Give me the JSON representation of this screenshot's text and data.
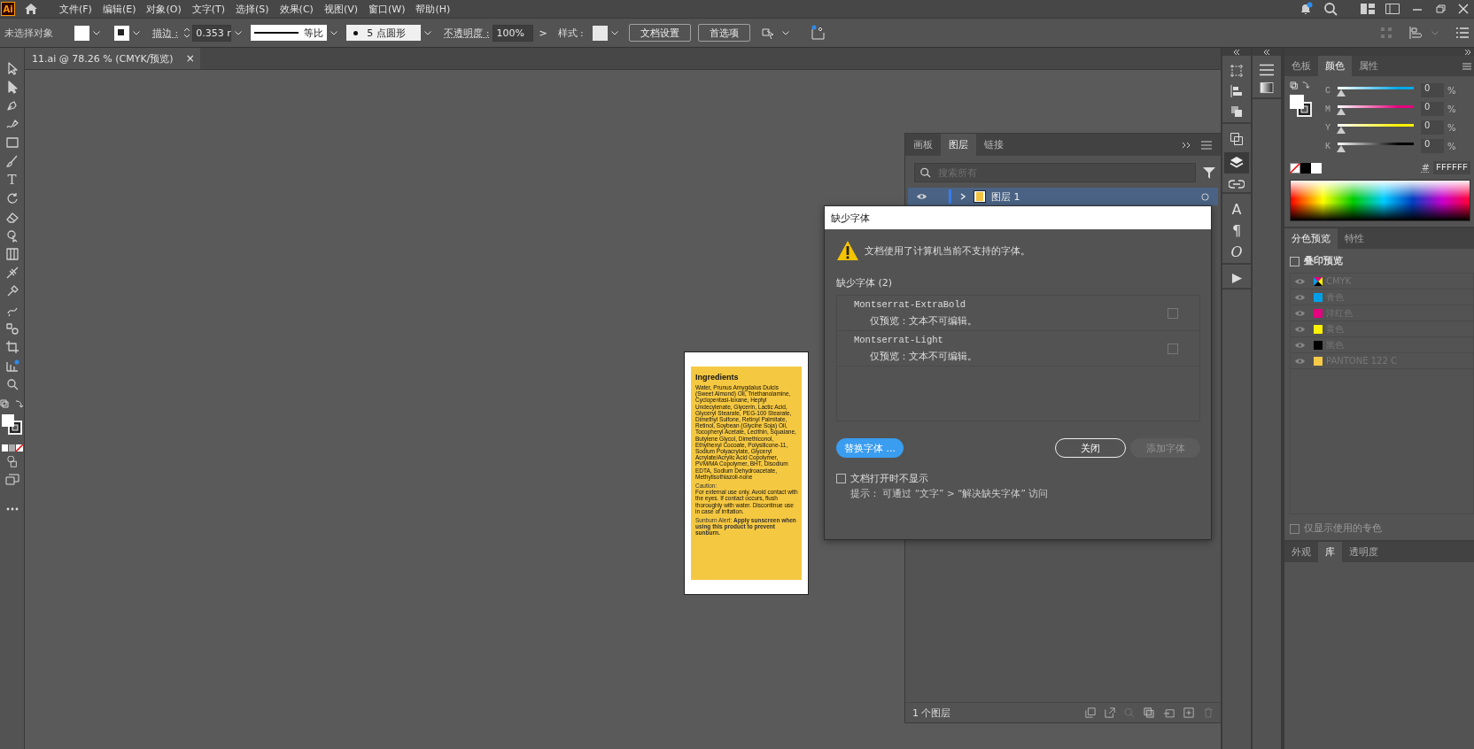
{
  "app": {
    "logo": "Ai"
  },
  "menu": [
    "文件(F)",
    "编辑(E)",
    "对象(O)",
    "文字(T)",
    "选择(S)",
    "效果(C)",
    "视图(V)",
    "窗口(W)",
    "帮助(H)"
  ],
  "control_bar": {
    "selection": "未选择对象",
    "stroke_label": "描边 :",
    "stroke_weight": "0.353 r",
    "stroke_profile": "等比",
    "brush": "5 点圆形",
    "opacity_label": "不透明度 :",
    "opacity": "100%",
    "opacity_arrow": ">",
    "style_label": "样式 :",
    "document_setup": "文档设置",
    "preferences": "首选项"
  },
  "document_tab": {
    "title": "11.ai @ 78.26 % (CMYK/预览)",
    "close": "×"
  },
  "toolbar": {
    "type_glyph": "T"
  },
  "artboard": {
    "heading": "Ingredients",
    "ingredients": "Water, Prunus Amygdalus Dulcis (Sweet Almond) Oil, Triethanolamine, Cyclopentasi-loxane, Heptyl Undecylenate, Glycerin, Lactic Acid, Glyceryl Stearate, PEG-100 Stearate, Dimethyl Sulfone, Retinyl Palmitate, Retinol, Soybean (Glycine Soja) Oil, Tocopheryl Acetate, Lecithin, Squalane, Butylene Glycol, Dimethiconol, Ethylhexyl Cocoate, Polysilicone-11, Sodium Polyacrylate, Glyceryl Acrylate/Acrylic Acid Copolymer, PVM/MA Copolymer, BHT, Disodium EDTA, Sodium Dehydroacetate, Methylisothiazoli-none",
    "caution_heading": "Caution:",
    "caution": "For external use only. Avoid contact with the eyes. If contact occurs, flush thoroughly with water. Discontinue use in case of irritation.",
    "sunburn": "Sunburn Alert: **Apply sunscreen when using this product to prevent sunburn.**"
  },
  "layers_panel": {
    "tabs": [
      {
        "label": "画板",
        "selected": false
      },
      {
        "label": "图层",
        "selected": true
      },
      {
        "label": "链接",
        "selected": false
      }
    ],
    "search": {
      "placeholder": "搜索所有"
    },
    "layers": [
      {
        "name": "图层 1",
        "visible": true,
        "expanded": false,
        "selected": true
      }
    ],
    "footer": "1 个图层"
  },
  "dialog": {
    "title": "缺少字体",
    "message": "文档使用了计算机当前不支持的字体。",
    "list_heading": "缺少字体 (2)",
    "fonts": [
      {
        "name": "Montserrat-ExtraBold",
        "note": "仅预览：文本不可编辑。",
        "checked": false
      },
      {
        "name": "Montserrat-Light",
        "note": "仅预览：文本不可编辑。",
        "checked": false
      }
    ],
    "replace_button": "替换字体 ...",
    "close_button": "关闭",
    "add_button": {
      "label": "添加字体",
      "disabled": true
    },
    "dont_show": {
      "label": "文档打开时不显示",
      "checked": false
    },
    "hint": "提示： 可通过 “文字” > “解决缺失字体” 访问"
  },
  "dock": {
    "character_glyph": "A",
    "paragraph_glyph": "¶",
    "opentype_glyph": "O"
  },
  "color_panel": {
    "tabs": [
      {
        "label": "色板",
        "selected": false
      },
      {
        "label": "颜色",
        "selected": true
      },
      {
        "label": "属性",
        "selected": false
      }
    ],
    "channels": [
      {
        "name": "C",
        "value": "0",
        "unit": "%",
        "level": 0,
        "color": "#00a8e8"
      },
      {
        "name": "M",
        "value": "0",
        "unit": "%",
        "level": 0,
        "color": "#e6007e"
      },
      {
        "name": "Y",
        "value": "0",
        "unit": "%",
        "level": 0,
        "color": "#fff000"
      },
      {
        "name": "K",
        "value": "0",
        "unit": "%",
        "level": 0,
        "color": "#000000"
      }
    ],
    "hash": "#",
    "hex": "FFFFFF"
  },
  "separations_panel": {
    "tabs": [
      {
        "label": "分色预览",
        "selected": true
      },
      {
        "label": "特性",
        "selected": false
      }
    ],
    "overprint": {
      "label": "叠印预览",
      "checked": false
    },
    "inks": [
      {
        "name": "CMYK",
        "kind": "composite"
      },
      {
        "name": "青色",
        "kind": "ink",
        "color": "#00a0e9"
      },
      {
        "name": "洋红色",
        "kind": "ink",
        "color": "#e4007f"
      },
      {
        "name": "黄色",
        "kind": "ink",
        "color": "#fff100"
      },
      {
        "name": "黑色",
        "kind": "ink",
        "color": "#000000"
      },
      {
        "name": "PANTONE 122 C",
        "kind": "ink",
        "color": "#f7c948"
      }
    ],
    "spot_only": {
      "label": "仅显示使用的专色",
      "checked": false
    }
  },
  "bottom_tabs": [
    {
      "label": "外观",
      "selected": false
    },
    {
      "label": "库",
      "selected": true
    },
    {
      "label": "透明度",
      "selected": false
    }
  ]
}
